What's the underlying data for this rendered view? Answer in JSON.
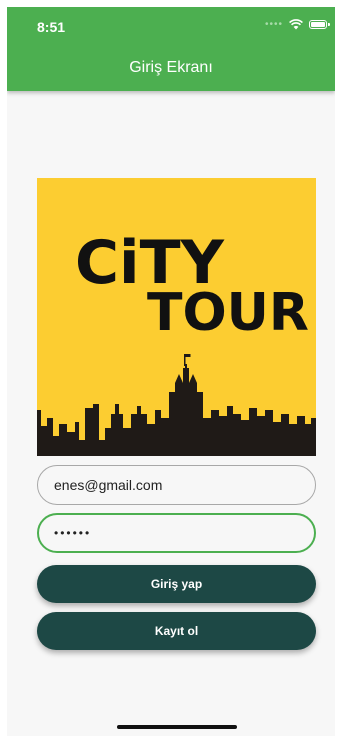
{
  "status_bar": {
    "time": "8:51"
  },
  "appbar": {
    "title": "Giriş Ekranı",
    "color": "#4caf50"
  },
  "logo": {
    "line1": "CiTY",
    "line2": "TOUR",
    "background": "#fccd31"
  },
  "form": {
    "email_value": "enes@gmail.com",
    "password_value": "••••••"
  },
  "buttons": {
    "login_label": "Giriş yap",
    "register_label": "Kayıt ol",
    "color": "#1d4845"
  }
}
